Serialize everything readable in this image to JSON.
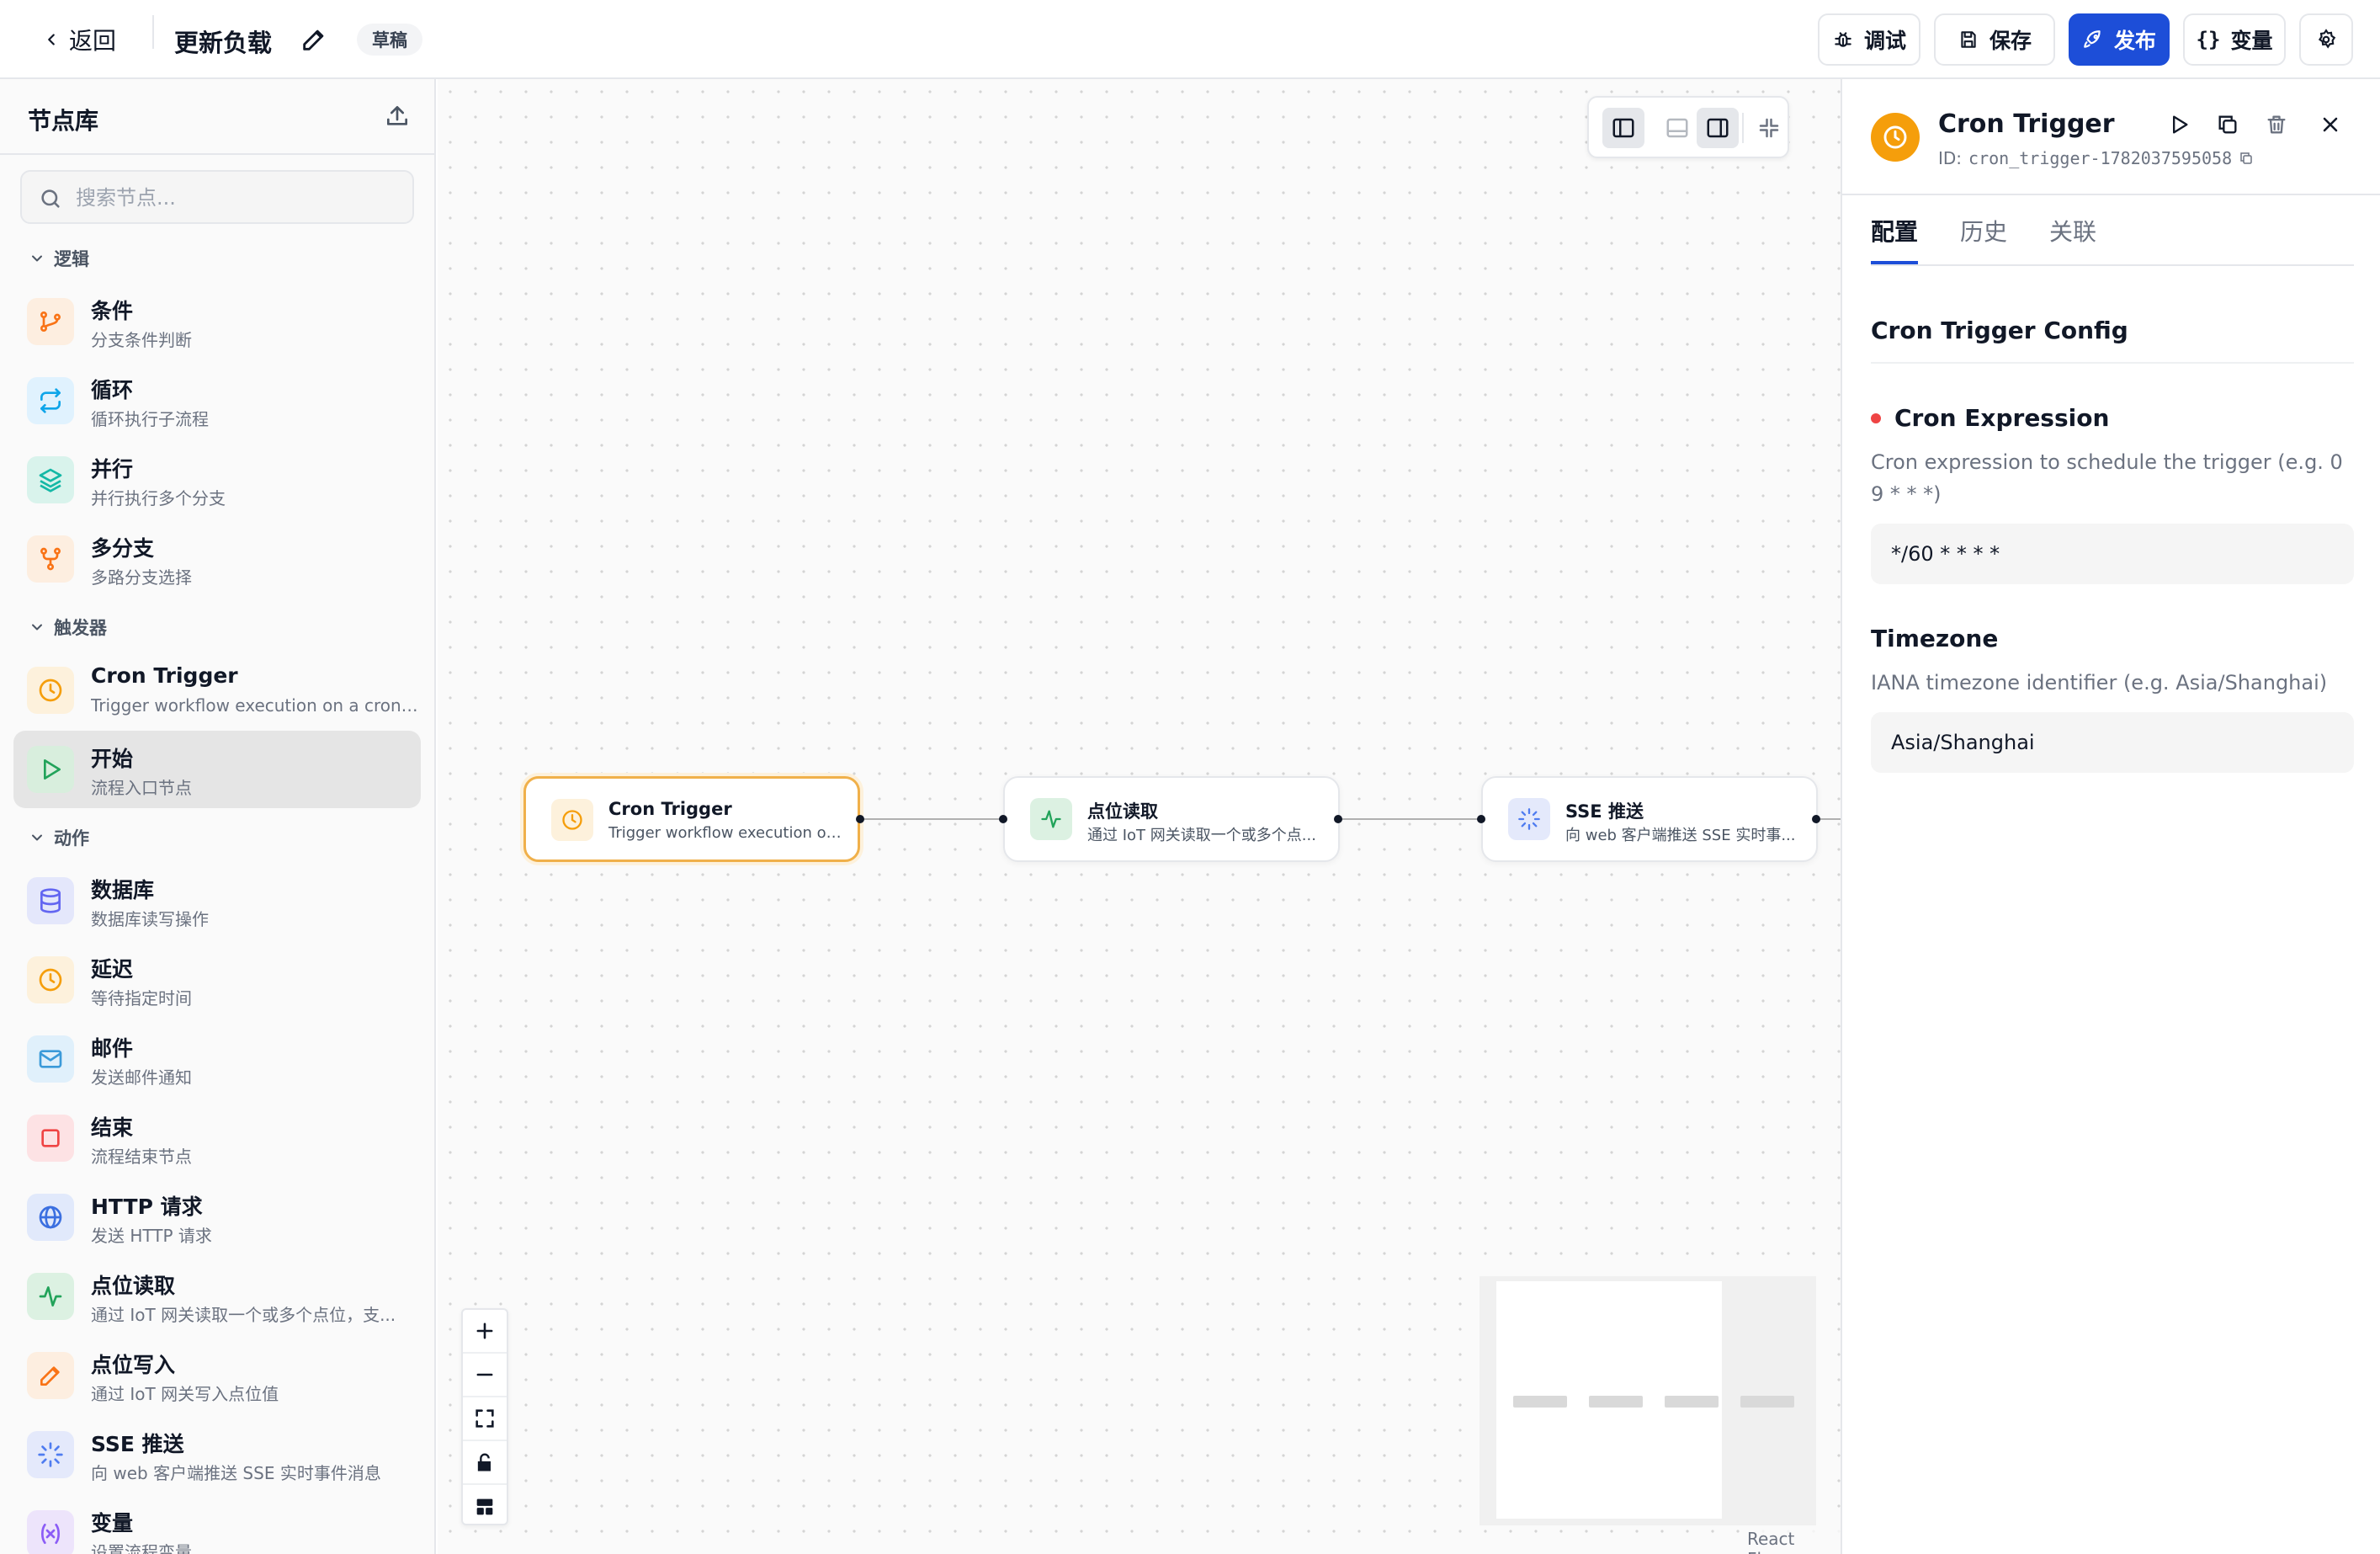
{
  "topbar": {
    "back_label": "返回",
    "workflow_title": "更新负载",
    "status_badge": "草稿",
    "buttons": {
      "debug": "调试",
      "save": "保存",
      "publish": "发布",
      "variables": "变量"
    },
    "colors": {
      "primary": "#1d4ed8"
    }
  },
  "sidebar": {
    "title": "节点库",
    "search_placeholder": "搜索节点...",
    "categories": {
      "logic": "逻辑",
      "triggers": "触发器",
      "actions": "动作"
    },
    "logic_items": [
      {
        "label": "条件",
        "desc": "分支条件判断",
        "icon": "git-branch-icon"
      },
      {
        "label": "循环",
        "desc": "循环执行子流程",
        "icon": "repeat-icon"
      },
      {
        "label": "并行",
        "desc": "并行执行多个分支",
        "icon": "layers-icon"
      },
      {
        "label": "多分支",
        "desc": "多路分支选择",
        "icon": "git-fork-icon"
      }
    ],
    "trigger_items": [
      {
        "label": "Cron Trigger",
        "desc": "Trigger workflow execution on a cron ...",
        "icon": "clock-icon"
      },
      {
        "label": "开始",
        "desc": "流程入口节点",
        "icon": "play-icon"
      }
    ],
    "action_items": [
      {
        "label": "数据库",
        "desc": "数据库读写操作",
        "icon": "database-icon"
      },
      {
        "label": "延迟",
        "desc": "等待指定时间",
        "icon": "clock-icon"
      },
      {
        "label": "邮件",
        "desc": "发送邮件通知",
        "icon": "mail-icon"
      },
      {
        "label": "结束",
        "desc": "流程结束节点",
        "icon": "square-icon"
      },
      {
        "label": "HTTP 请求",
        "desc": "发送 HTTP 请求",
        "icon": "globe-icon"
      },
      {
        "label": "点位读取",
        "desc": "通过 IoT 网关读取一个或多个点位，支...",
        "icon": "activity-icon"
      },
      {
        "label": "点位写入",
        "desc": "通过 IoT 网关写入点位值",
        "icon": "pencil-icon"
      },
      {
        "label": "SSE 推送",
        "desc": "向 web 客户端推送 SSE 实时事件消息",
        "icon": "loader-icon"
      },
      {
        "label": "变量",
        "desc": "设置流程变量",
        "icon": "variable-icon"
      }
    ]
  },
  "canvas": {
    "nodes": [
      {
        "title": "Cron Trigger",
        "desc": "Trigger workflow execution on ...",
        "icon": "clock-icon"
      },
      {
        "title": "点位读取",
        "desc": "通过 IoT 网关读取一个或多个点...",
        "icon": "activity-icon"
      },
      {
        "title": "SSE 推送",
        "desc": "向 web 客户端推送 SSE 实时事...",
        "icon": "loader-icon"
      }
    ],
    "attribution": "React Flow"
  },
  "panel": {
    "title": "Cron Trigger",
    "id_label": "ID:",
    "id_value": "cron_trigger-1782037595058",
    "tabs": [
      "配置",
      "历史",
      "关联"
    ],
    "config_title": "Cron Trigger Config",
    "fields": {
      "cron": {
        "label": "Cron Expression",
        "help": "Cron expression to schedule the trigger (e.g. 0 9 * * *)",
        "value": "*/60 * * * *"
      },
      "timezone": {
        "label": "Timezone",
        "help": "IANA timezone identifier (e.g. Asia/Shanghai)",
        "value": "Asia/Shanghai"
      }
    },
    "colors": {
      "trigger": "#f59e0b",
      "required": "#ef4444"
    }
  }
}
